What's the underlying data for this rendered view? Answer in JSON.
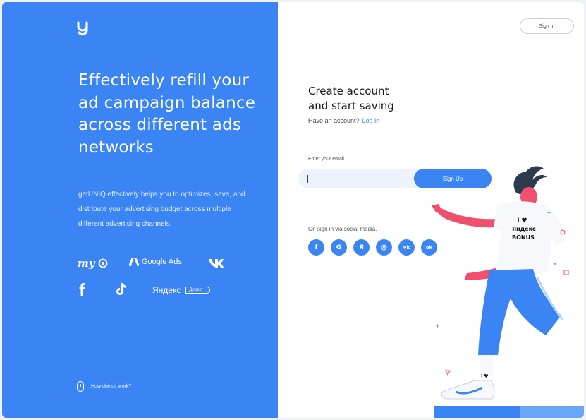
{
  "hero": {
    "headline": "Effectively refill your ad campaign balance across different ads networks",
    "description": "getUNIQ effectively helps you to optimizes, save, and distribute your advertising budget across multiple different advertising channels.",
    "how_link": "How does it work?"
  },
  "partners": {
    "mytarget": "my",
    "google_ads": "Google Ads",
    "yandex": "Яндекс",
    "yandex_tag": "Директ"
  },
  "header": {
    "signin_label": "Sign In"
  },
  "form": {
    "title_line1": "Create account",
    "title_line2": "and start saving",
    "have_account": "Have an account?",
    "login_link": "Log in",
    "email_label": "Enter your email",
    "email_value": "",
    "email_placeholder": "",
    "signup_label": "Sign Up",
    "social_label": "Or, sign in via social media.",
    "social": [
      {
        "icon": "facebook-icon",
        "glyph": "f"
      },
      {
        "icon": "google-icon",
        "glyph": "G"
      },
      {
        "icon": "yandex-icon",
        "glyph": "Я"
      },
      {
        "icon": "mail-ru-icon",
        "glyph": "@"
      },
      {
        "icon": "vk-icon",
        "glyph": "vk"
      },
      {
        "icon": "odnoklassniki-icon",
        "glyph": "ok"
      }
    ]
  },
  "illustration": {
    "shirt_line1": "I ♥",
    "shirt_line2": "Яндекс",
    "shirt_line3": "BONUS",
    "sock_text": "I ♥"
  },
  "colors": {
    "brand_blue": "#3a84f4",
    "light_blue": "#edf3fd",
    "skin_pink": "#f0506e",
    "hair_dark": "#2c3b4e"
  }
}
